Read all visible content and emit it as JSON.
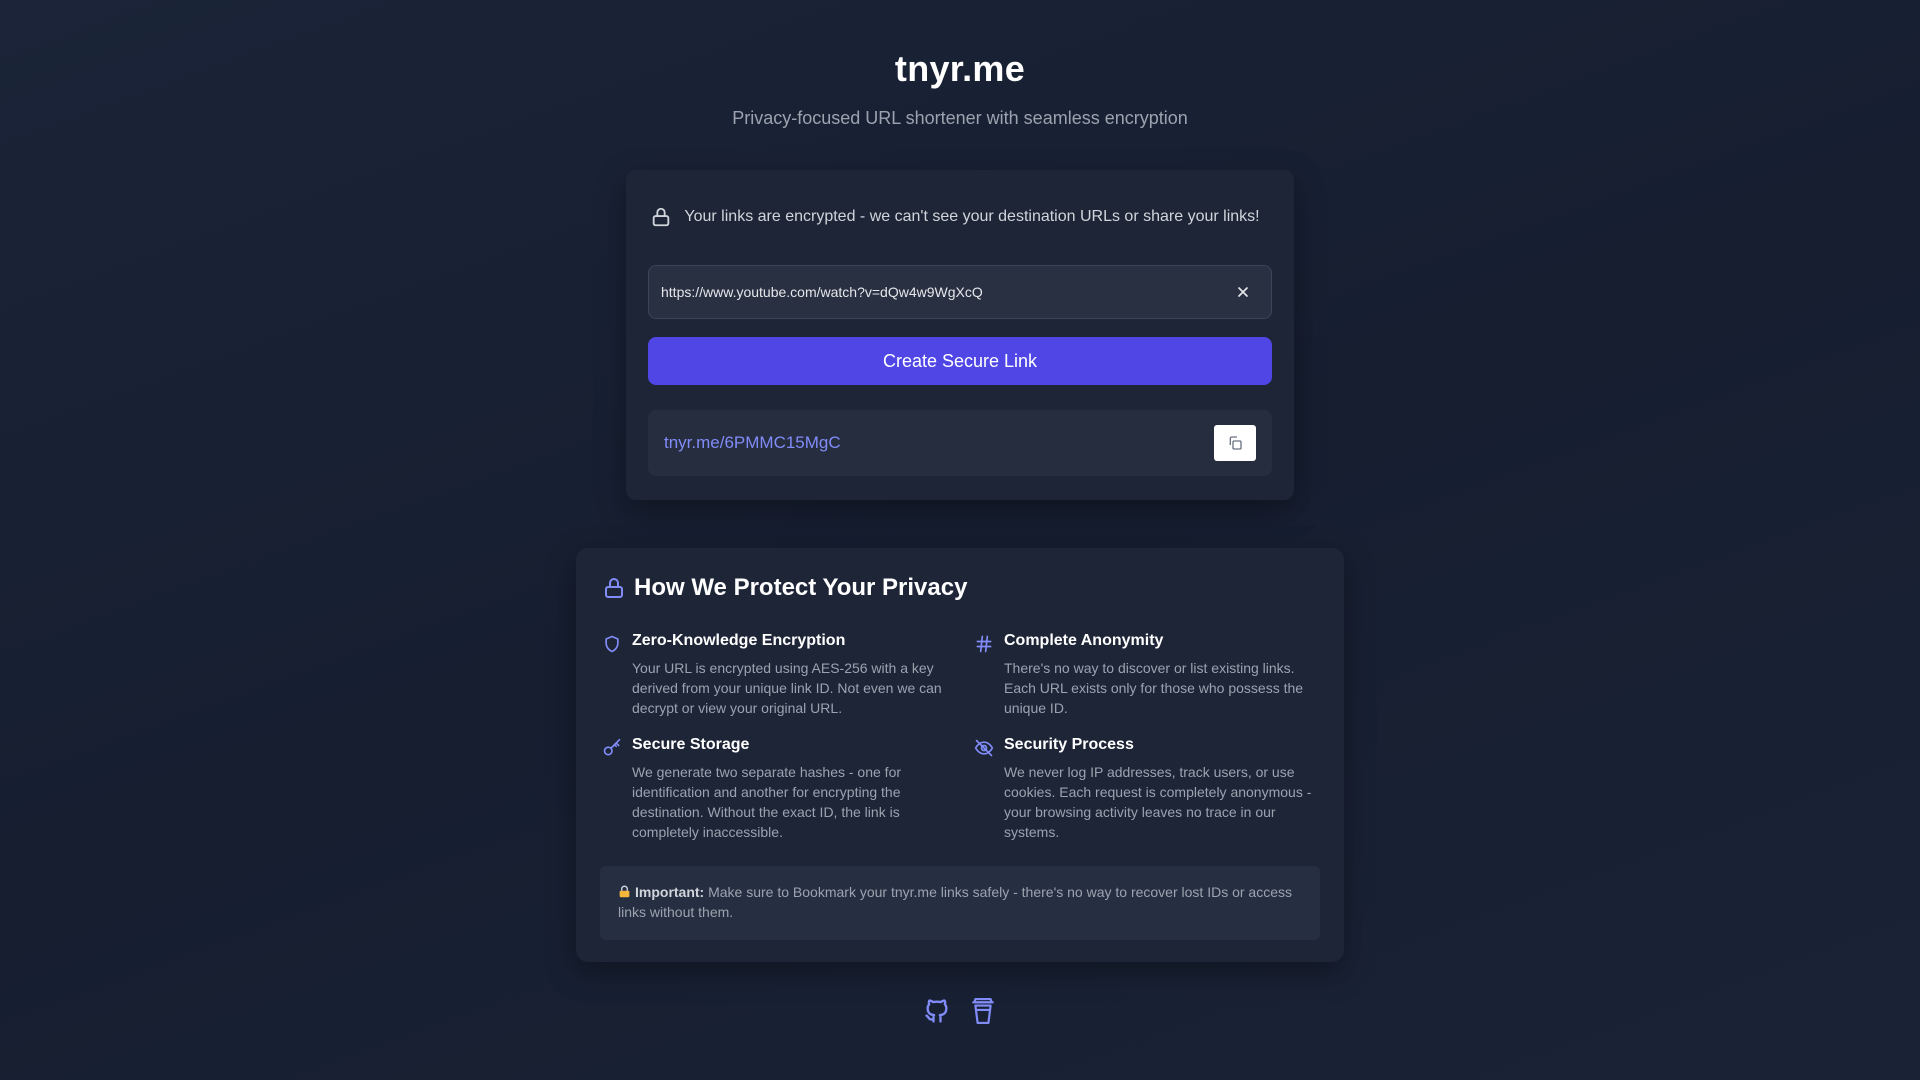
{
  "header": {
    "title": "tnyr.me",
    "subtitle": "Privacy-focused URL shortener with seamless encryption"
  },
  "shortener": {
    "notice": "Your links are encrypted - we can't see your destination URLs or share your links!",
    "url_value": "https://www.youtube.com/watch?v=dQw4w9WgXcQ",
    "create_label": "Create Secure Link",
    "result_link": "tnyr.me/6PMMC15MgC"
  },
  "privacy": {
    "heading": "How We Protect Your Privacy",
    "features": [
      {
        "icon": "shield-icon",
        "title": "Zero-Knowledge Encryption",
        "desc": "Your URL is encrypted using AES-256 with a key derived from your unique link ID. Not even we can decrypt or view your original URL."
      },
      {
        "icon": "hash-icon",
        "title": "Complete Anonymity",
        "desc": "There's no way to discover or list existing links. Each URL exists only for those who possess the unique ID."
      },
      {
        "icon": "key-icon",
        "title": "Secure Storage",
        "desc": "We generate two separate hashes - one for identification and another for encrypting the destination. Without the exact ID, the link is completely inaccessible."
      },
      {
        "icon": "eye-off-icon",
        "title": "Security Process",
        "desc": "We never log IP addresses, track users, or use cookies. Each request is completely anonymous - your browsing activity leaves no trace in our systems."
      }
    ],
    "important_label": "Important:",
    "important_text": " Make sure to Bookmark your tnyr.me links safely - there's no way to recover lost IDs or access links without them."
  },
  "footer": {
    "icons": [
      "github-icon",
      "coffee-cup-icon"
    ]
  },
  "colors": {
    "accent": "#4f46e5",
    "link": "#818cf8",
    "card": "#1d2537",
    "background": "#18202f"
  }
}
